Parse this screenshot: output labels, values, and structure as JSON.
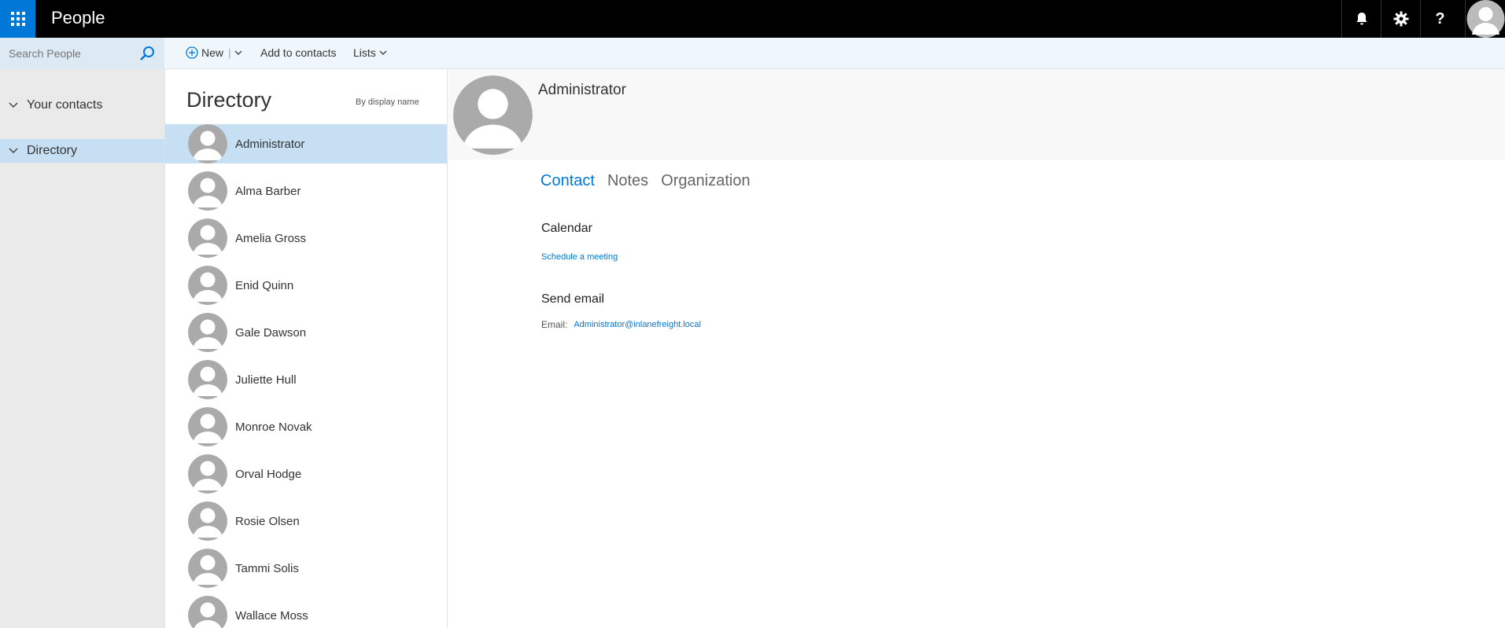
{
  "app": {
    "title": "People"
  },
  "search": {
    "placeholder": "Search People"
  },
  "nav": {
    "items": [
      {
        "label": "Your contacts",
        "selected": false
      },
      {
        "label": "Directory",
        "selected": true
      }
    ]
  },
  "toolbar": {
    "new_label": "New",
    "add_label": "Add to contacts",
    "lists_label": "Lists"
  },
  "directory": {
    "title": "Directory",
    "sort": "By display name",
    "people": [
      "Administrator",
      "Alma Barber",
      "Amelia Gross",
      "Enid Quinn",
      "Gale Dawson",
      "Juliette Hull",
      "Monroe Novak",
      "Orval Hodge",
      "Rosie Olsen",
      "Tammi Solis",
      "Wallace Moss"
    ]
  },
  "details": {
    "name": "Administrator",
    "tabs": [
      "Contact",
      "Notes",
      "Organization"
    ],
    "calendar_title": "Calendar",
    "schedule_link": "Schedule a meeting",
    "send_email_title": "Send email",
    "email_label": "Email:",
    "email_value": "Administrator@inlanefreight.local"
  },
  "colors": {
    "accent": "#0078d7",
    "topbar": "#000000",
    "selected": "#c7dff2",
    "toolbar": "#eff6fc"
  },
  "icons": [
    "app-launcher-icon",
    "bell-icon",
    "gear-icon",
    "help-icon",
    "user-avatar-icon",
    "search-icon",
    "plus-circle-icon",
    "chevron-down-icon"
  ]
}
